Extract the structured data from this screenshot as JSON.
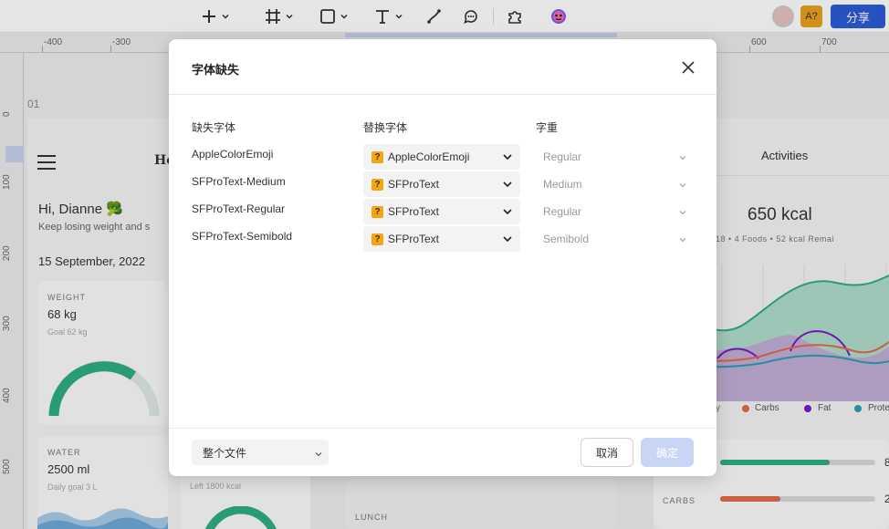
{
  "toolbar": {
    "share_label": "分享",
    "collab_avatar_letter": "A?",
    "icons": [
      "plus-icon",
      "frame-icon",
      "rectangle-icon",
      "text-icon",
      "pen-icon",
      "comment-icon",
      "plugin-icon",
      "ai-assistant-icon"
    ]
  },
  "rulers": {
    "h_labels": [
      "-400",
      "-300",
      "600",
      "700"
    ],
    "v_labels": [
      "0",
      "100",
      "200",
      "300",
      "400",
      "500"
    ]
  },
  "canvas": {
    "frame_label": "01",
    "greeting": "Hi, Dianne 🥦",
    "subtitle": "Keep losing weight and s",
    "header_partial": "Ho",
    "date": "15 September, 2022",
    "weight_caption": "WEIGHT",
    "weight_value": "68 kg",
    "weight_goal": "Goal 62 kg",
    "water_caption": "WATER",
    "water_value": "2500 ml",
    "water_goal": "Daily goal 3 L",
    "left_kcal": "Left 1800 kcal",
    "lunch": "LUNCH",
    "activities": "Activities",
    "kcal": "650 kcal",
    "kcal_meta": "er 18  •  4 Foods  •  52 kcal Remai",
    "legend": [
      "y",
      "Carbs",
      "Fat",
      "Prote"
    ],
    "carbs_caption": "CARBS",
    "bar_value_1": "8",
    "bar_value_2": "2"
  },
  "modal": {
    "title": "字体缺失",
    "col_missing": "缺失字体",
    "col_replace": "替换字体",
    "col_weight": "字重",
    "rows": [
      {
        "missing": "AppleColorEmoji",
        "replacement": "AppleColorEmoji",
        "weight": "Regular"
      },
      {
        "missing": "SFProText-Medium",
        "replacement": "SFProText",
        "weight": "Medium"
      },
      {
        "missing": "SFProText-Regular",
        "replacement": "SFProText",
        "weight": "Regular"
      },
      {
        "missing": "SFProText-Semibold",
        "replacement": "SFProText",
        "weight": "Semibold"
      }
    ],
    "badge": "?",
    "scope": "整个文件",
    "cancel_label": "取消",
    "ok_label": "确定"
  },
  "colors": {
    "primary": "#2b5bd7",
    "primary_disabled": "#c9d5f4",
    "missing_badge": "#f3a610",
    "chart_green": "#2fae82",
    "chart_purple": "#7a1bc9",
    "chart_coral": "#e36a4a",
    "chart_teal": "#2a9fb0"
  }
}
